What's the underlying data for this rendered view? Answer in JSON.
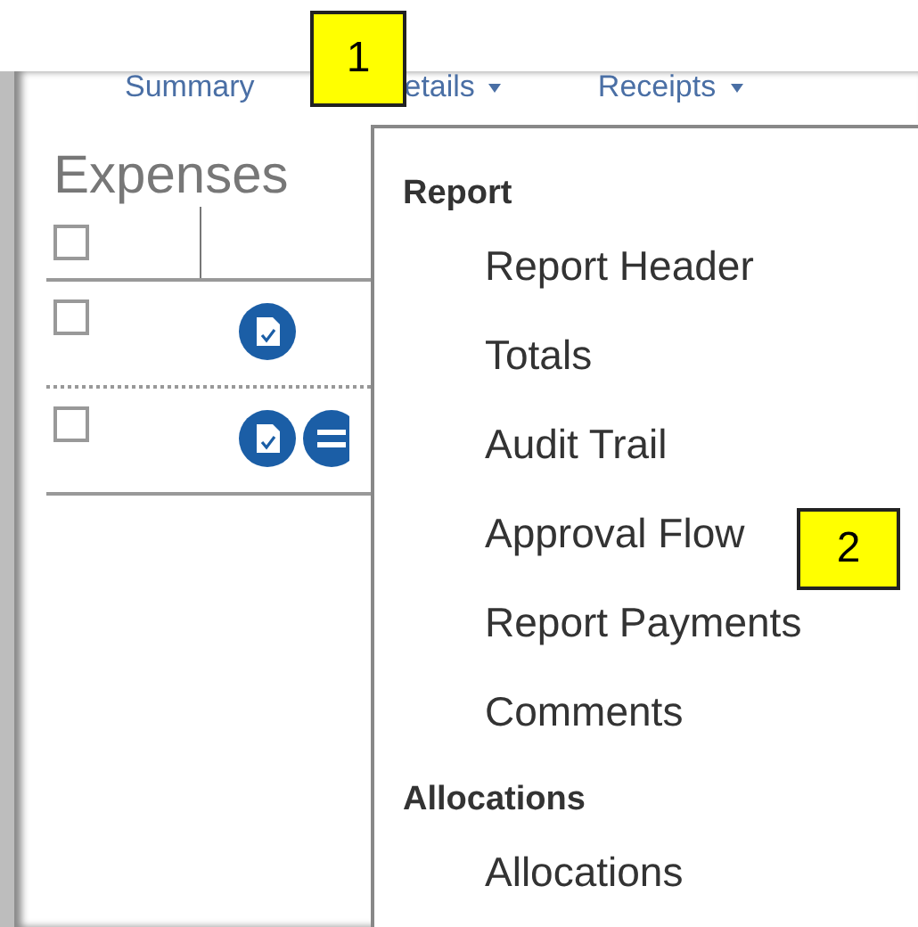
{
  "nav": [
    {
      "label": "Summary",
      "dropdown": false
    },
    {
      "label": "etails",
      "dropdown": true
    },
    {
      "label": "Receipts",
      "dropdown": true
    }
  ],
  "expenses": {
    "title": "Expenses",
    "header_checked": false,
    "rows": [
      {
        "checked": false,
        "icons": [
          {
            "kind": "receipt"
          }
        ]
      },
      {
        "checked": false,
        "icons": [
          {
            "kind": "receipt"
          },
          {
            "kind": "itemized"
          }
        ]
      }
    ]
  },
  "menu": {
    "sections": [
      {
        "title": "Report",
        "items": [
          "Report Header",
          "Totals",
          "Audit Trail",
          "Approval Flow",
          "Report Payments",
          "Comments"
        ]
      },
      {
        "title": "Allocations",
        "items": [
          "Allocations"
        ]
      }
    ]
  },
  "callouts": [
    "1",
    "2"
  ]
}
